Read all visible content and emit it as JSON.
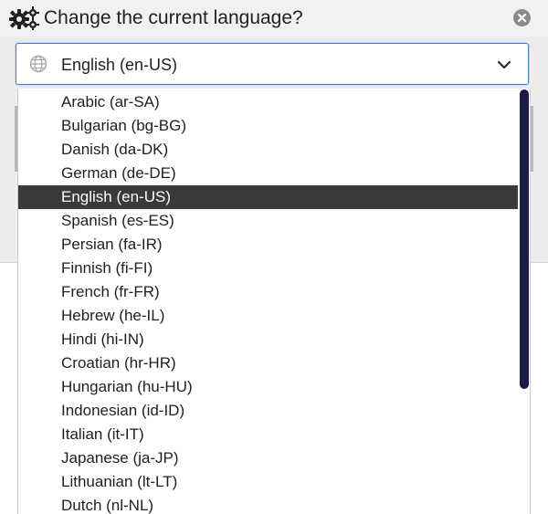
{
  "dialog": {
    "title": "Change the current language?",
    "title_icon": "gears-icon",
    "close_icon": "close-icon"
  },
  "select": {
    "icon": "globe-icon",
    "value": "English (en-US)",
    "chevron_icon": "chevron-down-icon"
  },
  "dropdown": {
    "selected_index": 4,
    "options": [
      "Arabic (ar-SA)",
      "Bulgarian (bg-BG)",
      "Danish (da-DK)",
      "German (de-DE)",
      "English (en-US)",
      "Spanish (es-ES)",
      "Persian (fa-IR)",
      "Finnish (fi-FI)",
      "French (fr-FR)",
      "Hebrew (he-IL)",
      "Hindi (hi-IN)",
      "Croatian (hr-HR)",
      "Hungarian (hu-HU)",
      "Indonesian (id-ID)",
      "Italian (it-IT)",
      "Japanese (ja-JP)",
      "Lithuanian (lt-LT)",
      "Dutch (nl-NL)"
    ]
  },
  "colors": {
    "accent_border": "#3d7fd8",
    "selected_bg": "#3a3a3a",
    "scroll_thumb": "#1c1a4a"
  }
}
